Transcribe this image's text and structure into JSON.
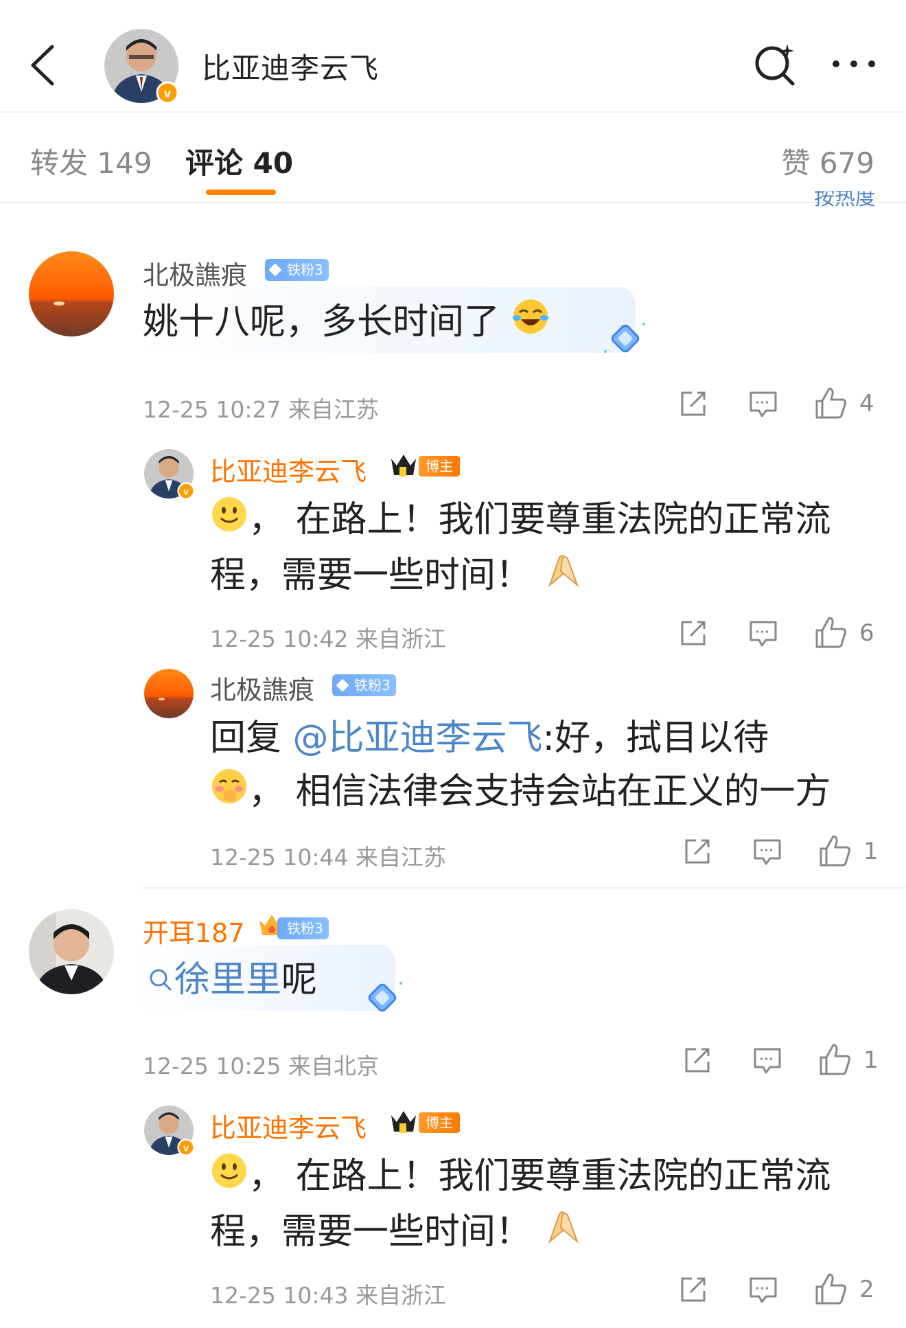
{
  "header": {
    "title": "比亚迪李云飞"
  },
  "tabs": {
    "repost": "转发 149",
    "comment": "评论 40",
    "like": "赞 679"
  },
  "sort_remnant": "按热度",
  "comments": [
    {
      "user": "北极譙痕",
      "badge": "铁粉3",
      "text": "姚十八呢，多长时间了",
      "time_loc": "12-25 10:27  来自江苏",
      "likes": "4",
      "reply": {
        "user": "比亚迪李云飞",
        "badge": "博主",
        "text_a": "，  在路上！我们要尊重法院的正常流",
        "text_b": "程，需要一些时间！",
        "time_loc": "12-25 10:42  来自浙江",
        "likes": "6"
      },
      "reply2": {
        "user": "北极譙痕",
        "badge": "铁粉3",
        "prefix": "回复 ",
        "mention": "@比亚迪李云飞",
        "text_a": ":好，拭目以待",
        "text_b": "，  相信法律会支持会站在正义的一方",
        "time_loc": "12-25 10:44  来自江苏",
        "likes": "1"
      }
    },
    {
      "user": "开耳187",
      "badge": "铁粉3",
      "search_term": "徐里里",
      "text": "呢",
      "time_loc": "12-25 10:25  来自北京",
      "likes": "1",
      "reply": {
        "user": "比亚迪李云飞",
        "badge": "博主",
        "text_a": "，  在路上！我们要尊重法院的正常流",
        "text_b": "程，需要一些时间！",
        "time_loc": "12-25 10:43  来自浙江",
        "likes": "2"
      }
    }
  ],
  "colors": {
    "accent": "#ff8200",
    "link": "#4d86c8",
    "blogger_name": "#ff7200"
  }
}
